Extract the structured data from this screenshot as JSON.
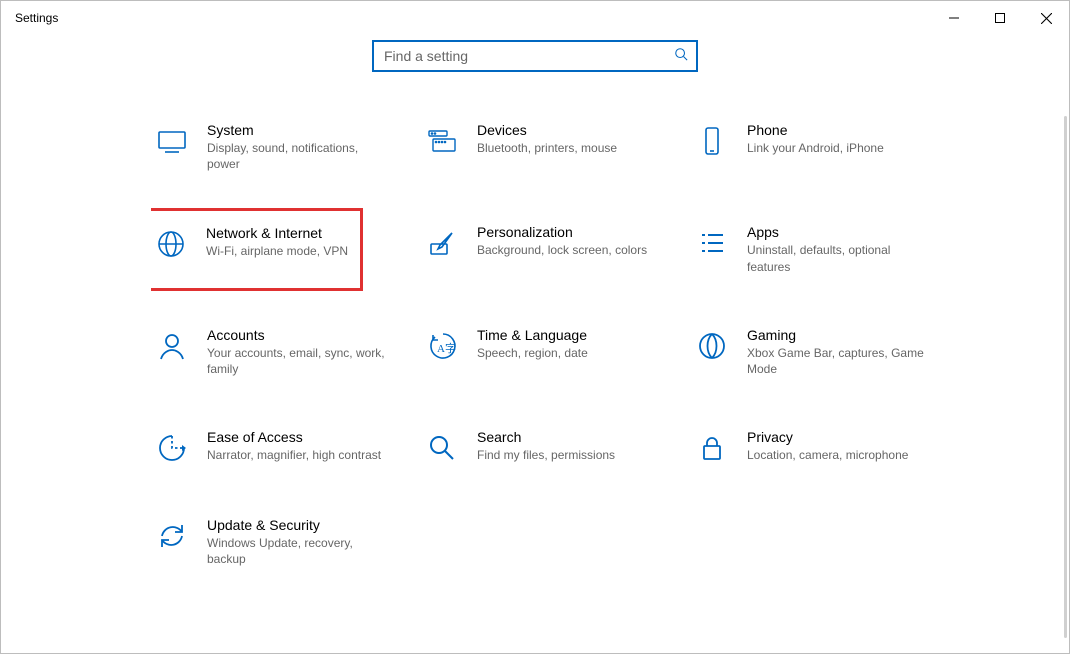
{
  "window": {
    "title": "Settings"
  },
  "search": {
    "placeholder": "Find a setting"
  },
  "tiles": [
    {
      "id": "system",
      "title": "System",
      "sub": "Display, sound, notifications, power"
    },
    {
      "id": "devices",
      "title": "Devices",
      "sub": "Bluetooth, printers, mouse"
    },
    {
      "id": "phone",
      "title": "Phone",
      "sub": "Link your Android, iPhone"
    },
    {
      "id": "network",
      "title": "Network & Internet",
      "sub": "Wi-Fi, airplane mode, VPN",
      "highlight": true
    },
    {
      "id": "personalization",
      "title": "Personalization",
      "sub": "Background, lock screen, colors"
    },
    {
      "id": "apps",
      "title": "Apps",
      "sub": "Uninstall, defaults, optional features"
    },
    {
      "id": "accounts",
      "title": "Accounts",
      "sub": "Your accounts, email, sync, work, family"
    },
    {
      "id": "time",
      "title": "Time & Language",
      "sub": "Speech, region, date"
    },
    {
      "id": "gaming",
      "title": "Gaming",
      "sub": "Xbox Game Bar, captures, Game Mode"
    },
    {
      "id": "ease",
      "title": "Ease of Access",
      "sub": "Narrator, magnifier, high contrast"
    },
    {
      "id": "search",
      "title": "Search",
      "sub": "Find my files, permissions"
    },
    {
      "id": "privacy",
      "title": "Privacy",
      "sub": "Location, camera, microphone"
    },
    {
      "id": "update",
      "title": "Update & Security",
      "sub": "Windows Update, recovery, backup"
    }
  ]
}
